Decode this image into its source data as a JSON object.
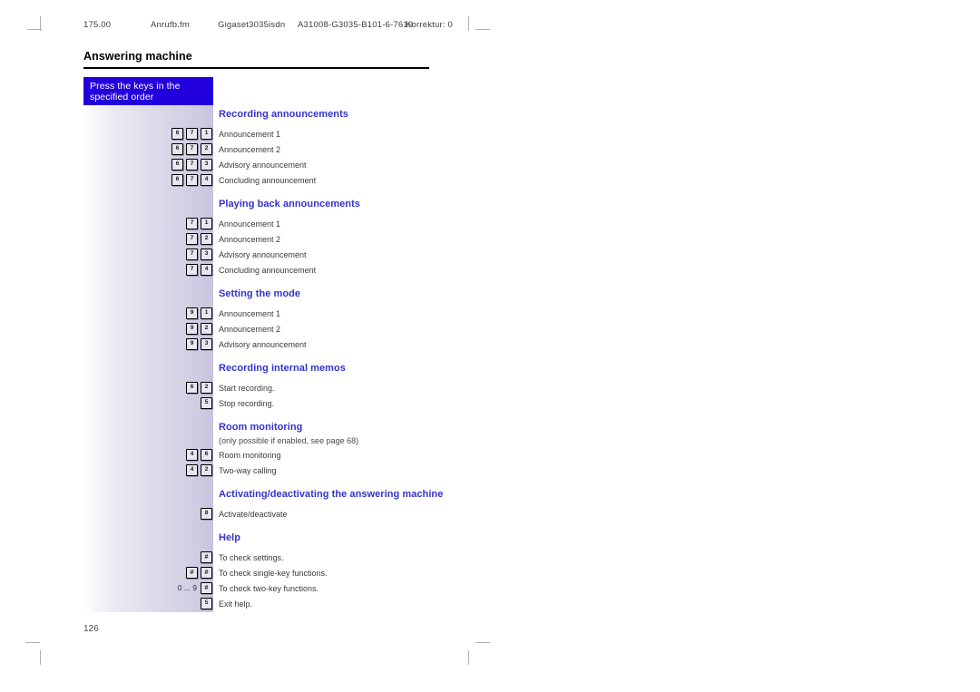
{
  "document": {
    "folio": "126",
    "chapter_title": "Answering machine"
  },
  "running_header": {
    "revision": "175.00",
    "file": "Anrufb.fm",
    "product": "Gigaset3035isdn",
    "doc_number": "A31008-G3035-B101-6-7619",
    "correction": "Korrektur: 0"
  },
  "callout": {
    "line1": "Press the keys in the",
    "line2": "specified order"
  },
  "colors": {
    "callout_bg": "#2200dd",
    "heading": "#3333cc",
    "rule": "#000000"
  },
  "sections": [
    {
      "heading": "Recording announcements",
      "note": "",
      "rows": [
        {
          "keys": [
            "6",
            "7",
            "1"
          ],
          "prefix": "",
          "label": "Announcement 1"
        },
        {
          "keys": [
            "6",
            "7",
            "2"
          ],
          "prefix": "",
          "label": "Announcement 2"
        },
        {
          "keys": [
            "6",
            "7",
            "3"
          ],
          "prefix": "",
          "label": "Advisory announcement"
        },
        {
          "keys": [
            "6",
            "7",
            "4"
          ],
          "prefix": "",
          "label": "Concluding announcement"
        }
      ]
    },
    {
      "heading": "Playing back announcements",
      "note": "",
      "rows": [
        {
          "keys": [
            "7",
            "1"
          ],
          "prefix": "",
          "label": "Announcement 1"
        },
        {
          "keys": [
            "7",
            "2"
          ],
          "prefix": "",
          "label": "Announcement 2"
        },
        {
          "keys": [
            "7",
            "3"
          ],
          "prefix": "",
          "label": "Advisory announcement"
        },
        {
          "keys": [
            "7",
            "4"
          ],
          "prefix": "",
          "label": "Concluding announcement"
        }
      ]
    },
    {
      "heading": "Setting the mode",
      "note": "",
      "rows": [
        {
          "keys": [
            "9",
            "1"
          ],
          "prefix": "",
          "label": "Announcement 1"
        },
        {
          "keys": [
            "9",
            "2"
          ],
          "prefix": "",
          "label": "Announcement 2"
        },
        {
          "keys": [
            "9",
            "3"
          ],
          "prefix": "",
          "label": "Advisory announcement"
        }
      ]
    },
    {
      "heading": "Recording internal memos",
      "note": "",
      "rows": [
        {
          "keys": [
            "6",
            "2"
          ],
          "prefix": "",
          "label": "Start recording."
        },
        {
          "keys": [
            "5"
          ],
          "prefix": "",
          "label": "Stop recording."
        }
      ]
    },
    {
      "heading": "Room monitoring",
      "note": "(only possible if enabled, see page 68)",
      "rows": [
        {
          "keys": [
            "4",
            "6"
          ],
          "prefix": "",
          "label": "Room monitoring"
        },
        {
          "keys": [
            "4",
            "2"
          ],
          "prefix": "",
          "label": "Two-way calling"
        }
      ]
    },
    {
      "heading": "Activating/deactivating the answering machine",
      "note": "",
      "rows": [
        {
          "keys": [
            "8"
          ],
          "prefix": "",
          "label": "Activate/deactivate"
        }
      ]
    },
    {
      "heading": "Help",
      "note": "",
      "rows": [
        {
          "keys": [
            "#"
          ],
          "prefix": "",
          "label": "To check settings."
        },
        {
          "keys": [
            "#",
            "#"
          ],
          "prefix": "",
          "label": "To check single-key functions."
        },
        {
          "keys": [
            "#"
          ],
          "prefix": "0 ... 9",
          "label": "To check two-key functions."
        },
        {
          "keys": [
            "5"
          ],
          "prefix": "",
          "label": "Exit help."
        }
      ]
    }
  ]
}
